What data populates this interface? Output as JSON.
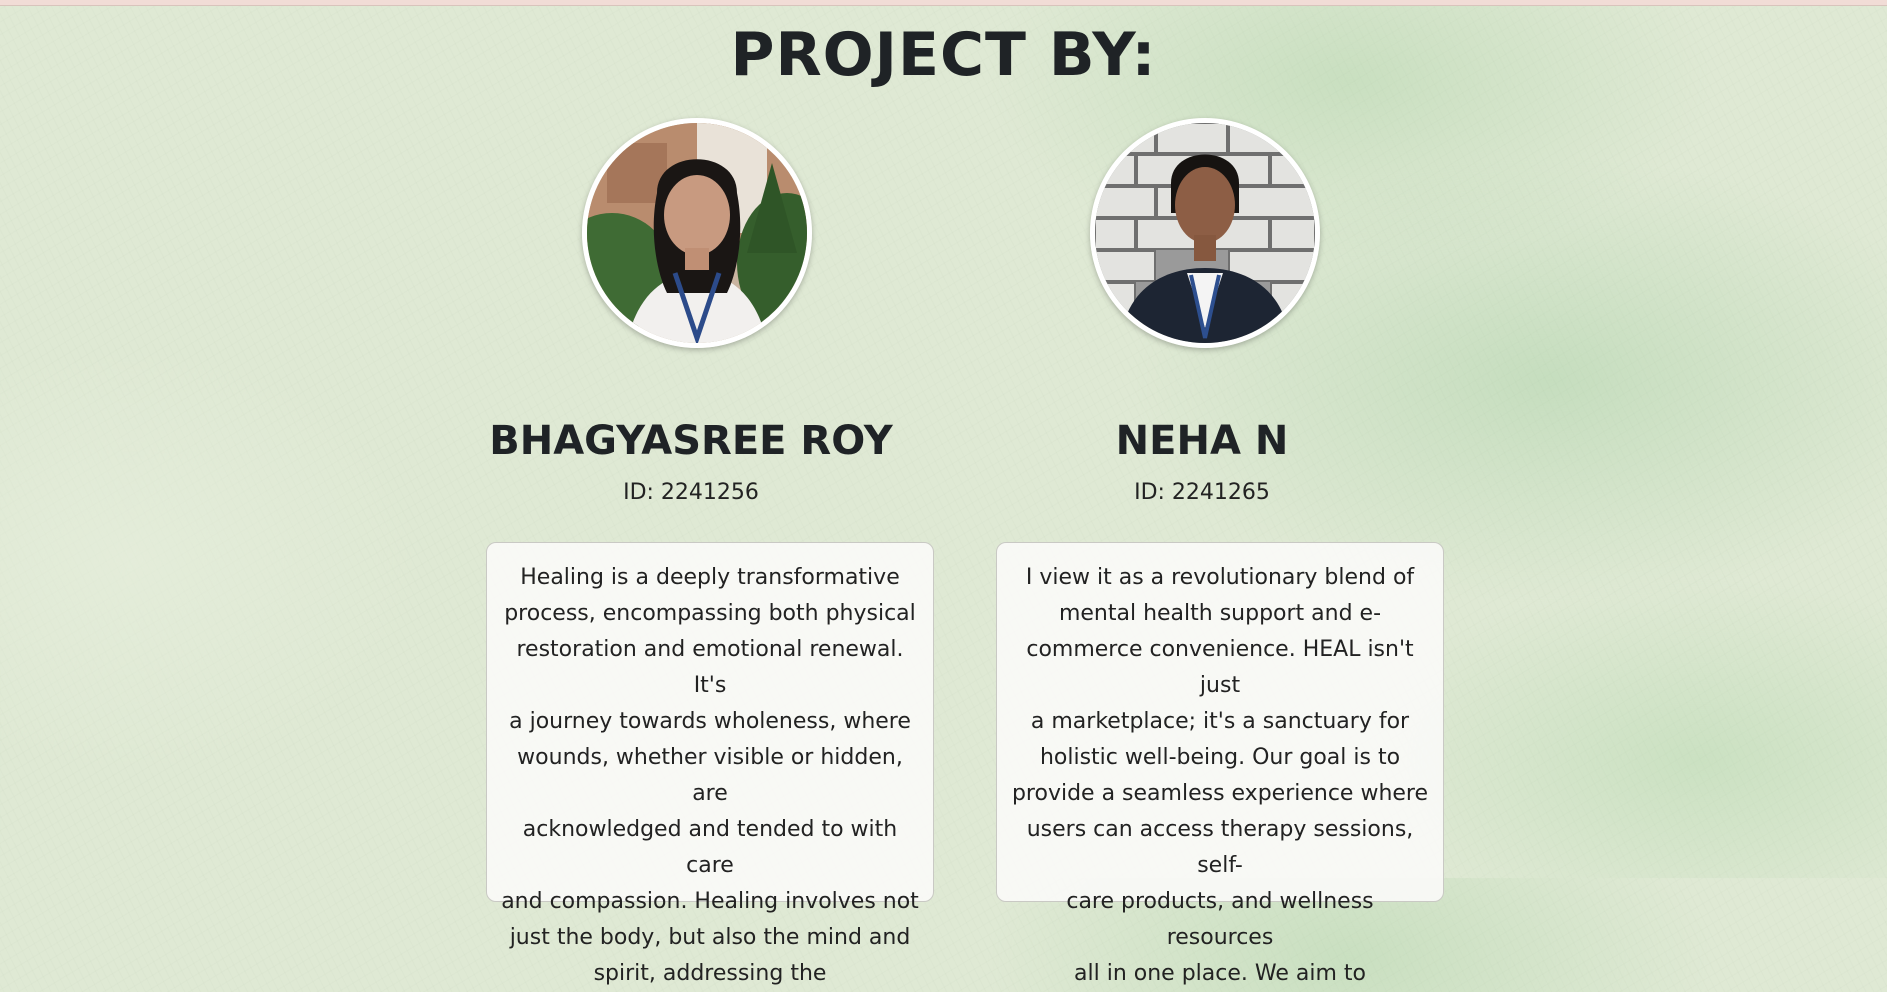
{
  "page": {
    "title": "PROJECT BY:"
  },
  "members": [
    {
      "name": "BHAGYASREE ROY",
      "id_label": "ID: 2241256",
      "bio_lines": [
        "Healing is a deeply transformative",
        "process, encompassing both physical",
        "restoration and emotional renewal. It's",
        "a journey towards wholeness, where",
        "wounds, whether visible or hidden, are",
        "acknowledged and tended to with care",
        "and compassion. Healing involves not",
        "just the body, but also the mind and",
        "spirit, addressing the"
      ]
    },
    {
      "name": "NEHA N",
      "id_label": "ID: 2241265",
      "bio_lines": [
        "I view it as a revolutionary blend of",
        "mental health support and e-",
        "commerce convenience. HEAL isn't just",
        "a marketplace; it's a sanctuary for",
        "holistic well-being. Our goal is to",
        "provide a seamless experience where",
        "users can access therapy sessions, self-",
        "care products, and wellness resources",
        "all in one place. We aim to"
      ]
    }
  ],
  "colors": {
    "background": "#dfe9d4",
    "card_background": "#fafaf7",
    "text": "#222222",
    "top_strip": "#f1dcd6"
  }
}
